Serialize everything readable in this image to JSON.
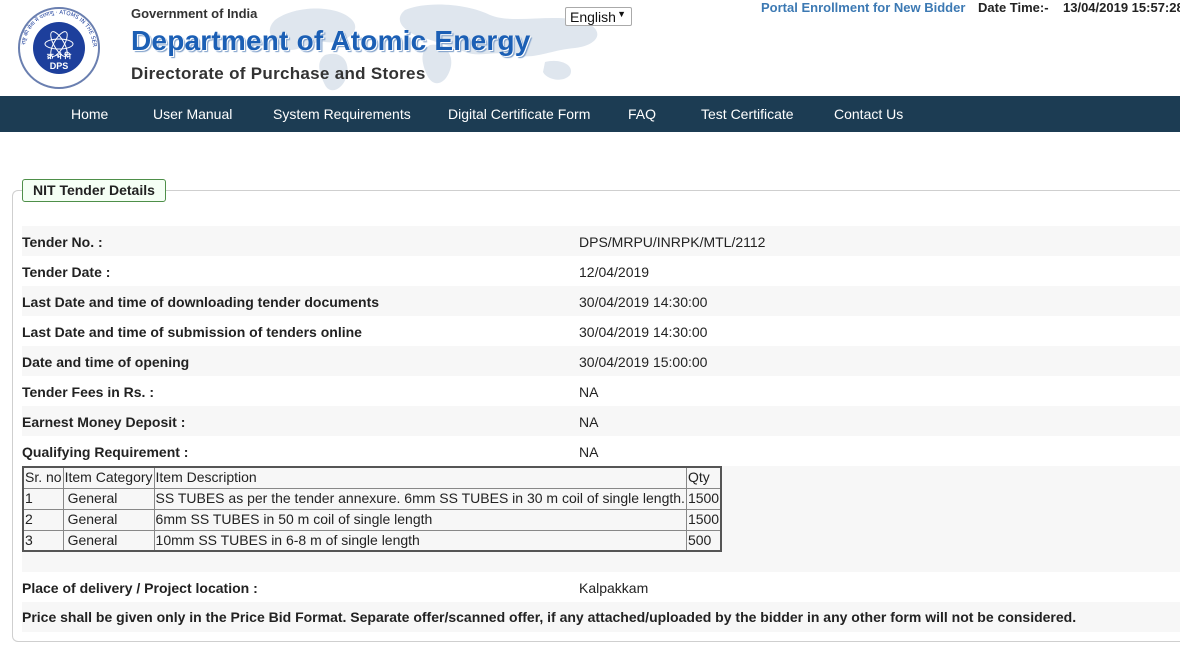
{
  "header": {
    "seal_text": "राष्ट्र की सेवा में परमाणु · ATOMS IN THE SERVICE OF THE NATION",
    "seal_center": "क्र भं नि",
    "seal_abbr": "DPS",
    "government": "Government of India",
    "department": "Department of Atomic Energy",
    "directorate": "Directorate of Purchase and Stores"
  },
  "language": {
    "selected": "English"
  },
  "top_links": {
    "enrollment": "Portal Enrollment for New Bidder",
    "date_time_label": "Date Time:-",
    "date_time_value": "13/04/2019 15:57:28"
  },
  "nav": [
    "Home",
    "User Manual",
    "System Requirements",
    "Digital Certificate Form",
    "FAQ",
    "Test Certificate",
    "Contact Us"
  ],
  "section": {
    "title": "NIT Tender Details"
  },
  "details": [
    {
      "label": "Tender No. :",
      "value": "DPS/MRPU/INRPK/MTL/2112"
    },
    {
      "label": "Tender Date :",
      "value": "12/04/2019"
    },
    {
      "label": "Last Date and time of downloading tender documents",
      "value": "30/04/2019 14:30:00"
    },
    {
      "label": "Last Date and time of submission of tenders online",
      "value": "30/04/2019 14:30:00"
    },
    {
      "label": "Date and time of opening",
      "value": "30/04/2019 15:00:00"
    },
    {
      "label": "Tender Fees in Rs. :",
      "value": "NA"
    },
    {
      "label": "Earnest Money Deposit :",
      "value": "NA"
    },
    {
      "label": "Qualifying Requirement :",
      "value": "NA"
    }
  ],
  "items_table": {
    "headers": [
      "Sr. no",
      "Item Category",
      "Item Description",
      "Qty"
    ],
    "rows": [
      [
        "1",
        "General",
        "SS TUBES as per the tender annexure. 6mm SS TUBES in 30 m coil of single length.",
        "1500"
      ],
      [
        "2",
        "General",
        "6mm SS TUBES in 50 m coil of single length",
        "1500"
      ],
      [
        "3",
        "General",
        "10mm SS TUBES in 6-8 m of single length",
        "500"
      ]
    ]
  },
  "delivery": {
    "label": "Place of delivery / Project location :",
    "value": "Kalpakkam"
  },
  "note": "Price shall be given only in the Price Bid Format. Separate offer/scanned offer, if any attached/uploaded by the bidder in any other form will not be considered.",
  "colors": {
    "nav_bg": "#1c3c53",
    "department_blue": "#1b5fb5",
    "link_blue": "#3c79b3",
    "legend_border": "#4e8f49"
  }
}
